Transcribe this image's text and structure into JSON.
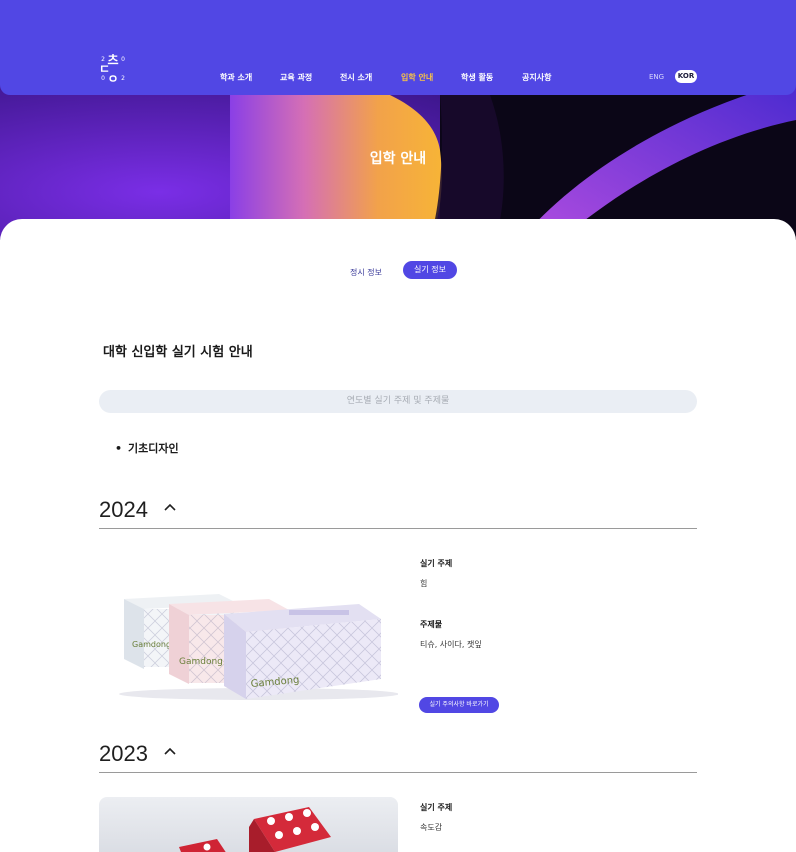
{
  "logo": {
    "tl": "2",
    "tr": "0",
    "center": "츠",
    "bl": "0",
    "br": "2",
    "mid_left": "ㄷ",
    "mid_bottom": "ㅇ"
  },
  "nav": {
    "items": [
      {
        "label": "학과 소개",
        "active": false
      },
      {
        "label": "교육 과정",
        "active": false
      },
      {
        "label": "전시 소개",
        "active": false
      },
      {
        "label": "입학 안내",
        "active": true
      },
      {
        "label": "학생 활동",
        "active": false
      },
      {
        "label": "공지사항",
        "active": false
      }
    ],
    "lang_eng": "ENG",
    "lang_kor": "KOR"
  },
  "hero": {
    "title": "입학 안내"
  },
  "tabs": {
    "regular": "정시 정보",
    "practical": "실기 정보"
  },
  "section": {
    "title": "대학 신입학 실기 시험 안내",
    "year_bar": "연도별 실기 주제 및 주제물",
    "category": "기초디자인"
  },
  "entries": [
    {
      "year": "2024",
      "topic_label": "실기 주제",
      "topic": "힘",
      "object_label": "주제물",
      "objects": "티슈, 사이다, 잿잎",
      "button": "실기 주의사항 바로가기",
      "image": "tissue-boxes",
      "brand_text": "Gamdong"
    },
    {
      "year": "2023",
      "topic_label": "실기 주제",
      "topic": "속도감",
      "image": "red-dice"
    }
  ],
  "colors": {
    "primary": "#5147e4",
    "active_nav": "#f7c247",
    "bar_bg": "#eaeef4"
  }
}
